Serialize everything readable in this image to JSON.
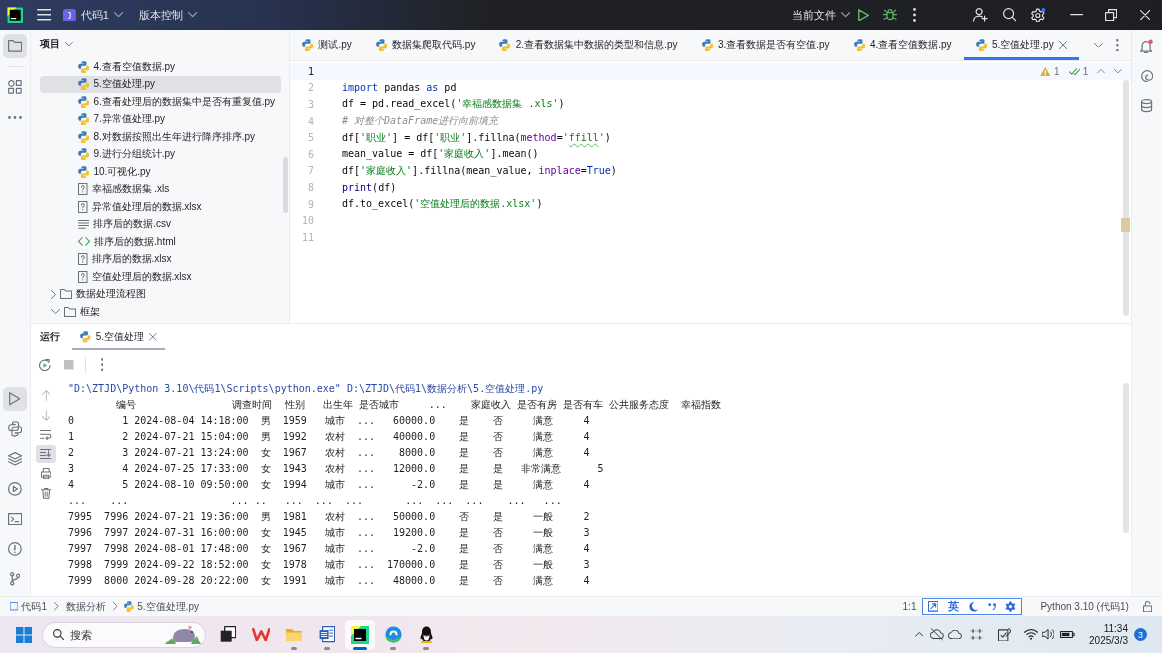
{
  "title_bar": {
    "project": "代码1",
    "vcs": "版本控制",
    "run_config": "当前文件"
  },
  "left_tools": {
    "top": [
      {
        "kind": "project",
        "selected": true
      },
      {
        "kind": "structure",
        "selected": false
      },
      {
        "kind": "more",
        "selected": false
      }
    ],
    "bottom": [
      {
        "kind": "run",
        "selected": true
      },
      {
        "kind": "python_console",
        "selected": false
      },
      {
        "kind": "layers",
        "selected": false
      },
      {
        "kind": "services",
        "selected": false
      },
      {
        "kind": "terminal",
        "selected": false
      },
      {
        "kind": "problems",
        "selected": false
      },
      {
        "kind": "git",
        "selected": false
      }
    ]
  },
  "project_panel": {
    "title": "项目",
    "tree": [
      {
        "children": [
          {
            "label": "4.查看空值数据.py",
            "kind": "python",
            "selected": false
          },
          {
            "label": "5.空值处理.py",
            "kind": "python",
            "selected": true
          },
          {
            "label": "6.查看处理后的数据集中是否有重复值.py",
            "kind": "python",
            "selected": false
          },
          {
            "label": "7.异常值处理.py",
            "kind": "python",
            "selected": false
          },
          {
            "label": "8.对数据按照出生年进行降序排序.py",
            "kind": "python",
            "selected": false
          },
          {
            "label": "9.进行分组统计.py",
            "kind": "python",
            "selected": false
          },
          {
            "label": "10.可视化.py",
            "kind": "python",
            "selected": false
          },
          {
            "label": "幸福感数据集 .xls",
            "kind": "unknown",
            "selected": false
          },
          {
            "label": "异常值处理后的数据.xlsx",
            "kind": "unknown",
            "selected": false
          },
          {
            "label": "排序后的数据.csv",
            "kind": "text",
            "selected": false
          },
          {
            "label": "排序后的数据.html",
            "kind": "html",
            "selected": false
          },
          {
            "label": "排序后的数据.xlsx",
            "kind": "unknown",
            "selected": false
          },
          {
            "label": "空值处理后的数据.xlsx",
            "kind": "unknown",
            "selected": false
          }
        ]
      },
      {
        "label": "数据处理流程图",
        "kind": "folder",
        "expanded": false,
        "selected": false
      },
      {
        "label": "框架",
        "kind": "folder",
        "expanded": true,
        "selected": false
      }
    ]
  },
  "editor": {
    "tabs": [
      {
        "label": "测试.py",
        "selected": false
      },
      {
        "label": "数据集爬取代码.py",
        "selected": false
      },
      {
        "label": "2.查看数据集中数据的类型和信息.py",
        "selected": false
      },
      {
        "label": "3.查看数据是否有空值.py",
        "selected": false
      },
      {
        "label": "4.查看空值数据.py",
        "selected": false
      },
      {
        "label": "5.空值处理.py",
        "selected": true
      }
    ],
    "inspections": {
      "warnings": "1",
      "checks": "1"
    },
    "lines": [
      {
        "number": "1",
        "current": true
      },
      {
        "number": "2",
        "current": false,
        "tokens": [
          {
            "text": "import",
            "kind": "keyword"
          },
          {
            "text": " pandas ",
            "kind": "plain"
          },
          {
            "text": "as",
            "kind": "keyword"
          },
          {
            "text": " pd",
            "kind": "plain"
          }
        ]
      },
      {
        "number": "3",
        "current": false,
        "tokens": [
          {
            "text": "df = pd.read_excel(",
            "kind": "plain"
          },
          {
            "text": "'幸福感数据集 .xls'",
            "kind": "string"
          },
          {
            "text": ")",
            "kind": "plain"
          }
        ]
      },
      {
        "number": "4",
        "current": false,
        "tokens": [
          {
            "text": "# 对整个DataFrame进行向前填充",
            "kind": "comment"
          }
        ]
      },
      {
        "number": "5",
        "current": false,
        "tokens": [
          {
            "text": "df[",
            "kind": "plain"
          },
          {
            "text": "'职业'",
            "kind": "string"
          },
          {
            "text": "] = df[",
            "kind": "plain"
          },
          {
            "text": "'职业'",
            "kind": "string"
          },
          {
            "text": "].fillna(",
            "kind": "plain"
          },
          {
            "text": "method",
            "kind": "param"
          },
          {
            "text": "=",
            "kind": "plain"
          },
          {
            "text": "'",
            "kind": "string"
          },
          {
            "text": "ffill",
            "kind": "string_typo"
          },
          {
            "text": "'",
            "kind": "string"
          },
          {
            "text": ")",
            "kind": "plain"
          }
        ]
      },
      {
        "number": "6",
        "current": false,
        "tokens": [
          {
            "text": "mean_value = df[",
            "kind": "plain"
          },
          {
            "text": "'家庭收入'",
            "kind": "string"
          },
          {
            "text": "].mean()",
            "kind": "plain"
          }
        ]
      },
      {
        "number": "7",
        "current": false,
        "tokens": [
          {
            "text": "df[",
            "kind": "plain"
          },
          {
            "text": "'家庭收入'",
            "kind": "string"
          },
          {
            "text": "].fillna(mean_value, ",
            "kind": "plain"
          },
          {
            "text": "inplace",
            "kind": "param"
          },
          {
            "text": "=",
            "kind": "plain"
          },
          {
            "text": "True",
            "kind": "keyword"
          },
          {
            "text": ")",
            "kind": "plain"
          }
        ]
      },
      {
        "number": "8",
        "current": false,
        "tokens": [
          {
            "text": "print",
            "kind": "builtin"
          },
          {
            "text": "(df)",
            "kind": "plain"
          }
        ]
      },
      {
        "number": "9",
        "current": false,
        "tokens": [
          {
            "text": "df.to_excel(",
            "kind": "plain"
          },
          {
            "text": "'空值处理后的数据.xlsx'",
            "kind": "string"
          },
          {
            "text": ")",
            "kind": "plain"
          }
        ]
      },
      {
        "number": "10",
        "current": false
      },
      {
        "number": "11",
        "current": false
      }
    ]
  },
  "run_panel": {
    "title": "运行",
    "tabs": [
      {
        "label": "5.空值处理",
        "selected": true
      }
    ],
    "toolbar": [
      {
        "kind": "rerun",
        "disabled": false
      },
      {
        "kind": "stop",
        "disabled": true
      },
      {
        "kind": "more",
        "disabled": false
      }
    ],
    "side_tools": [
      {
        "kind": "up",
        "disabled": true,
        "on": false
      },
      {
        "kind": "down",
        "disabled": true,
        "on": false
      },
      {
        "kind": "wrap",
        "disabled": false,
        "on": false
      },
      {
        "kind": "scroll_end",
        "disabled": false,
        "on": true
      },
      {
        "kind": "print",
        "disabled": false,
        "on": false
      },
      {
        "kind": "clear",
        "disabled": false,
        "on": false
      }
    ],
    "console": [
      {
        "kind": "command",
        "text": "\"D:\\ZTJD\\Python 3.10\\代码1\\Scripts\\python.exe\" D:\\ZTJD\\代码1\\数据分析\\5.空值处理.py"
      },
      {
        "kind": "output",
        "text": "        编号                调查时间  性别   出生年 是否城市     ...    家庭收入 是否有房 是否有车 公共服务态度  幸福指数"
      },
      {
        "kind": "output",
        "text": "0        1 2024-08-04 14:18:00  男  1959   城市  ...   60000.0    是    否     满意     4"
      },
      {
        "kind": "output",
        "text": "1        2 2024-07-21 15:04:00  男  1992   农村  ...   40000.0    是    否     满意     4"
      },
      {
        "kind": "output",
        "text": "2        3 2024-07-21 13:24:00  女  1967   农村  ...    8000.0    是    否     满意     4"
      },
      {
        "kind": "output",
        "text": "3        4 2024-07-25 17:33:00  女  1943   农村  ...   12000.0    是    是   非常满意      5"
      },
      {
        "kind": "output",
        "text": "4        5 2024-08-10 09:50:00  女  1994   城市  ...      -2.0    是    是     满意     4"
      },
      {
        "kind": "output",
        "text": "...    ...                 ... ..   ...  ...  ...       ...  ...  ...    ...   ..."
      },
      {
        "kind": "output",
        "text": "7995  7996 2024-07-21 19:36:00  男  1981   农村  ...   50000.0    否    是     一般     2"
      },
      {
        "kind": "output",
        "text": "7996  7997 2024-07-31 16:00:00  女  1945   城市  ...   19200.0    是    否     一般     3"
      },
      {
        "kind": "output",
        "text": "7997  7998 2024-08-01 17:48:00  女  1967   城市  ...      -2.0    是    否     满意     4"
      },
      {
        "kind": "output",
        "text": "7998  7999 2024-09-22 18:52:00  女  1978   城市  ...  170000.0    是    否     一般     3"
      },
      {
        "kind": "output",
        "text": "7999  8000 2024-09-28 20:22:00  女  1991   城市  ...   48000.0    是    否     满意     4"
      }
    ]
  },
  "status_bar": {
    "breadcrumbs": [
      {
        "kind": "project",
        "label": "代码1"
      },
      {
        "kind": "folder",
        "label": "数据分析"
      },
      {
        "kind": "python",
        "label": "5.空值处理.py"
      }
    ],
    "position": "1:1",
    "interpreter": "Python 3.10 (代码1)"
  },
  "input_method": {
    "mode": "英"
  },
  "taskbar": {
    "search": {
      "placeholder": "搜索"
    },
    "apps": [
      {
        "kind": "task_view",
        "running": false,
        "selected": false
      },
      {
        "kind": "wps",
        "running": false,
        "selected": false
      },
      {
        "kind": "explorer",
        "running": true,
        "selected": false
      },
      {
        "kind": "word",
        "running": true,
        "selected": false
      },
      {
        "kind": "pycharm",
        "running": true,
        "selected": true
      },
      {
        "kind": "edge",
        "running": true,
        "selected": false
      },
      {
        "kind": "qq",
        "running": true,
        "selected": false
      }
    ],
    "clock": {
      "time": "11:34",
      "date": "2025/3/3"
    },
    "notifications": "3"
  }
}
